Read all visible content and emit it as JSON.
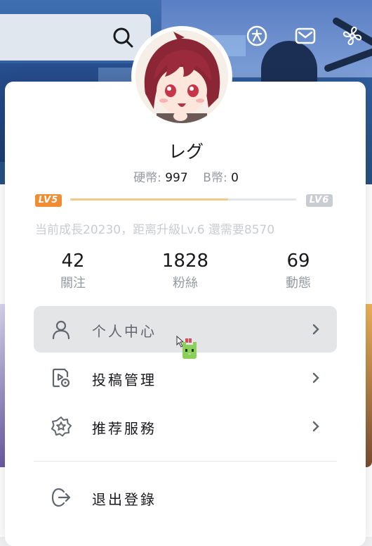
{
  "user": {
    "name": "レグ",
    "coins_label": "硬幣:",
    "coins_value": "997",
    "bcoins_label": "B幣:",
    "bcoins_value": "0"
  },
  "level": {
    "current_badge": "LV5",
    "next_badge": "LV6",
    "progress_fraction": 0.7,
    "growth_text": "当前成長20230，距离升級Lv.6 還需要8570"
  },
  "stats": [
    {
      "value": "42",
      "label": "關注"
    },
    {
      "value": "1828",
      "label": "粉絲"
    },
    {
      "value": "69",
      "label": "動態"
    }
  ],
  "menu": [
    {
      "label": "个人中心",
      "icon": "person-icon",
      "active": true
    },
    {
      "label": "投稿管理",
      "icon": "upload-manage-icon",
      "active": false
    },
    {
      "label": "推荐服務",
      "icon": "star-badge-icon",
      "active": false
    }
  ],
  "logout": {
    "label": "退出登錄",
    "icon": "logout-icon"
  },
  "top_icons": [
    "search-icon",
    "vip-icon",
    "message-icon",
    "fan-icon"
  ],
  "colors": {
    "level_current": "#f08c33",
    "level_next": "#c9ccd0",
    "progress": "#f3c88b",
    "active_bg": "#e3e5e7"
  }
}
